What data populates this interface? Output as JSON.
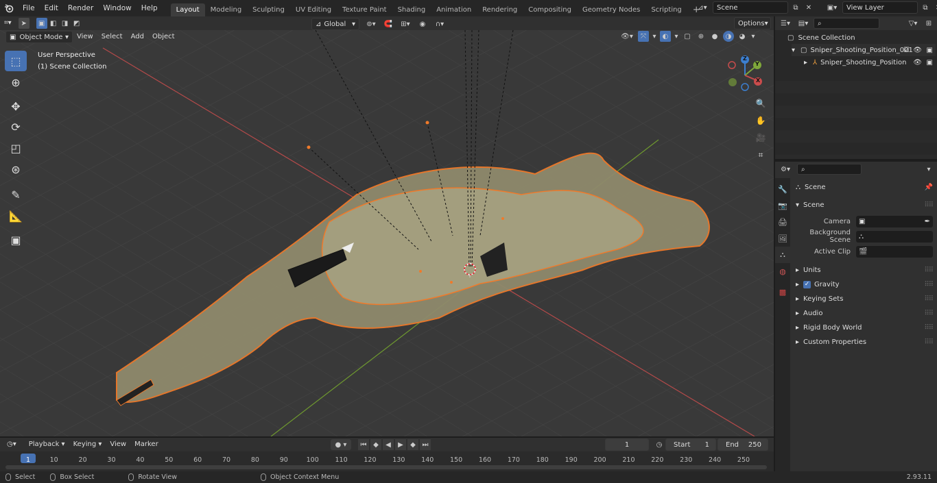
{
  "menu": [
    "File",
    "Edit",
    "Render",
    "Window",
    "Help"
  ],
  "workspaces": [
    "Layout",
    "Modeling",
    "Sculpting",
    "UV Editing",
    "Texture Paint",
    "Shading",
    "Animation",
    "Rendering",
    "Compositing",
    "Geometry Nodes",
    "Scripting"
  ],
  "active_workspace": "Layout",
  "scene_name": "Scene",
  "view_layer": "View Layer",
  "viewport": {
    "mode": "Object Mode",
    "menus": [
      "View",
      "Select",
      "Add",
      "Object"
    ],
    "transform_orientation": "Global",
    "options_label": "Options",
    "overlay_line1": "User Perspective",
    "overlay_line2": "(1) Scene Collection",
    "gizmo": {
      "z": "Z",
      "y": "Y",
      "x": "X"
    }
  },
  "outliner": {
    "root": "Scene Collection",
    "items": [
      {
        "label": "Sniper_Shooting_Position_001"
      },
      {
        "label": "Sniper_Shooting_Position"
      }
    ]
  },
  "properties": {
    "context": "Scene",
    "section": "Scene",
    "fields": [
      {
        "label": "Camera",
        "value": ""
      },
      {
        "label": "Background Scene",
        "value": ""
      },
      {
        "label": "Active Clip",
        "value": ""
      }
    ],
    "panels": [
      "Units",
      "Gravity",
      "Keying Sets",
      "Audio",
      "Rigid Body World",
      "Custom Properties"
    ]
  },
  "timeline": {
    "menus": [
      "Playback",
      "Keying",
      "View",
      "Marker"
    ],
    "current_frame": "1",
    "start_label": "Start",
    "start": "1",
    "end_label": "End",
    "end": "250",
    "ticks": [
      "1",
      "10",
      "20",
      "30",
      "40",
      "50",
      "60",
      "70",
      "80",
      "90",
      "100",
      "110",
      "120",
      "130",
      "140",
      "150",
      "160",
      "170",
      "180",
      "190",
      "200",
      "210",
      "220",
      "230",
      "240",
      "250"
    ]
  },
  "status": {
    "select": "Select",
    "box_select": "Box Select",
    "rotate": "Rotate View",
    "context_menu": "Object Context Menu",
    "version": "2.93.11"
  },
  "colors": {
    "accent": "#4772b3",
    "selection": "#f07a2a",
    "x_axis": "#c94c4c",
    "y_axis": "#7fa83a",
    "z_axis": "#3c7fd0"
  }
}
